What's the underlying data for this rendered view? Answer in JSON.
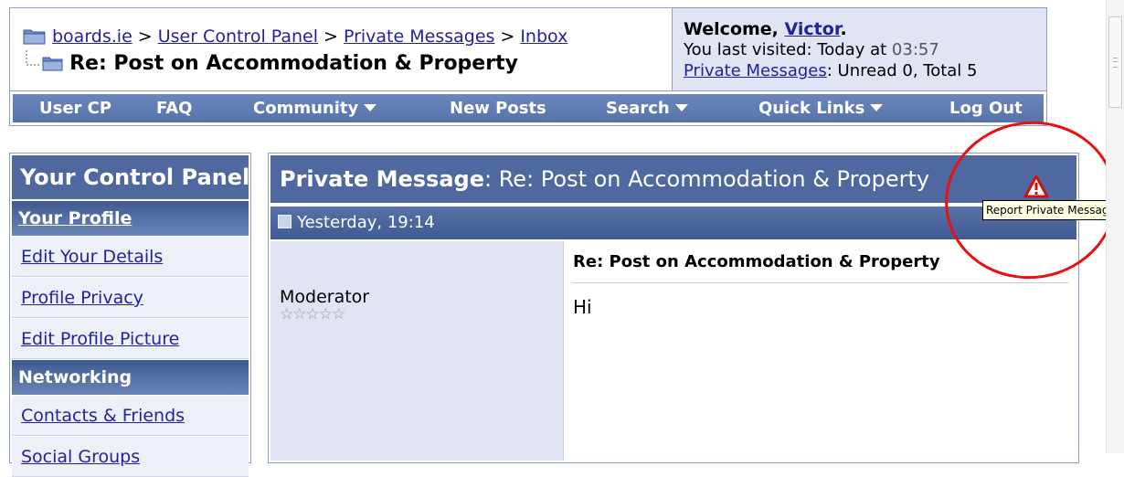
{
  "breadcrumb": {
    "items": [
      "boards.ie",
      "User Control Panel",
      "Private Messages",
      "Inbox"
    ],
    "separator": ">"
  },
  "page_title": "Re: Post on Accommodation & Property",
  "welcome": {
    "greeting": "Welcome,",
    "username": "Victor",
    "period": ".",
    "last_visited_label": "You last visited: Today at",
    "last_visited_time": "03:57",
    "pm_link": "Private Messages",
    "pm_status": ": Unread 0, Total 5"
  },
  "navbar": {
    "items": [
      {
        "label": "User CP",
        "dropdown": false
      },
      {
        "label": "FAQ",
        "dropdown": false
      },
      {
        "label": "Community",
        "dropdown": true
      },
      {
        "label": "New Posts",
        "dropdown": false
      },
      {
        "label": "Search",
        "dropdown": true
      },
      {
        "label": "Quick Links",
        "dropdown": true
      },
      {
        "label": "Log Out",
        "dropdown": false
      }
    ]
  },
  "sidebar": {
    "title": "Your Control Panel",
    "sections": [
      {
        "heading": "Your Profile",
        "links": [
          "Edit Your Details",
          "Profile Privacy",
          "Edit Profile Picture"
        ]
      },
      {
        "heading": "Networking",
        "links": [
          "Contacts & Friends",
          "Social Groups"
        ]
      }
    ]
  },
  "message": {
    "header_label": "Private Message",
    "header_subject": ": Re: Post on Accommodation & Property",
    "date": "Yesterday, 19:14",
    "sender_title": "Moderator",
    "stars": "☆☆☆☆☆",
    "title": "Re: Post on Accommodation & Property",
    "body": "Hi"
  },
  "report": {
    "icon": "warning-triangle-icon",
    "tooltip": "Report Private Message"
  },
  "colors": {
    "nav_bg": "#5f7ab2",
    "panel_head": "#4f68a0",
    "link": "#22229c",
    "annotation": "#e81010"
  }
}
